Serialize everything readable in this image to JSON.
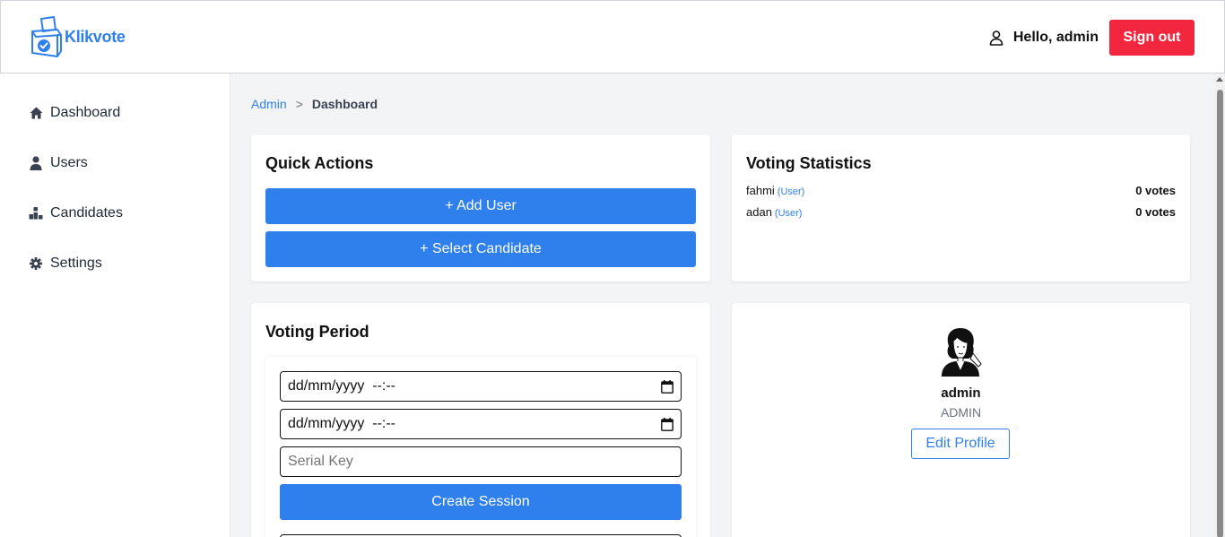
{
  "header": {
    "app_name": "Klikvote",
    "greeting": "Hello, admin",
    "signout_label": "Sign out",
    "brand_color": "#2f80ed",
    "signout_color": "#f2263c"
  },
  "sidebar": {
    "items": [
      {
        "label": "Dashboard",
        "icon": "home-icon"
      },
      {
        "label": "Users",
        "icon": "user-icon"
      },
      {
        "label": "Candidates",
        "icon": "podium-icon"
      },
      {
        "label": "Settings",
        "icon": "gear-icon"
      }
    ]
  },
  "breadcrumb": {
    "parent": "Admin",
    "separator": ">",
    "current": "Dashboard"
  },
  "quick_actions": {
    "title": "Quick Actions",
    "add_user_label": "+ Add User",
    "select_candidate_label": "+ Select Candidate"
  },
  "voting_statistics": {
    "title": "Voting Statistics",
    "rows": [
      {
        "name": "fahmi",
        "role": "(User)",
        "votes": "0 votes"
      },
      {
        "name": "adan",
        "role": "(User)",
        "votes": "0 votes"
      }
    ]
  },
  "voting_period": {
    "title": "Voting Period",
    "start_value": "dd/mm/yyyy  --:--",
    "end_value": "dd/mm/yyyy  --:--",
    "serial_placeholder": "Serial Key",
    "create_label": "Create Session"
  },
  "profile": {
    "name": "admin",
    "role": "ADMIN",
    "edit_label": "Edit Profile"
  }
}
